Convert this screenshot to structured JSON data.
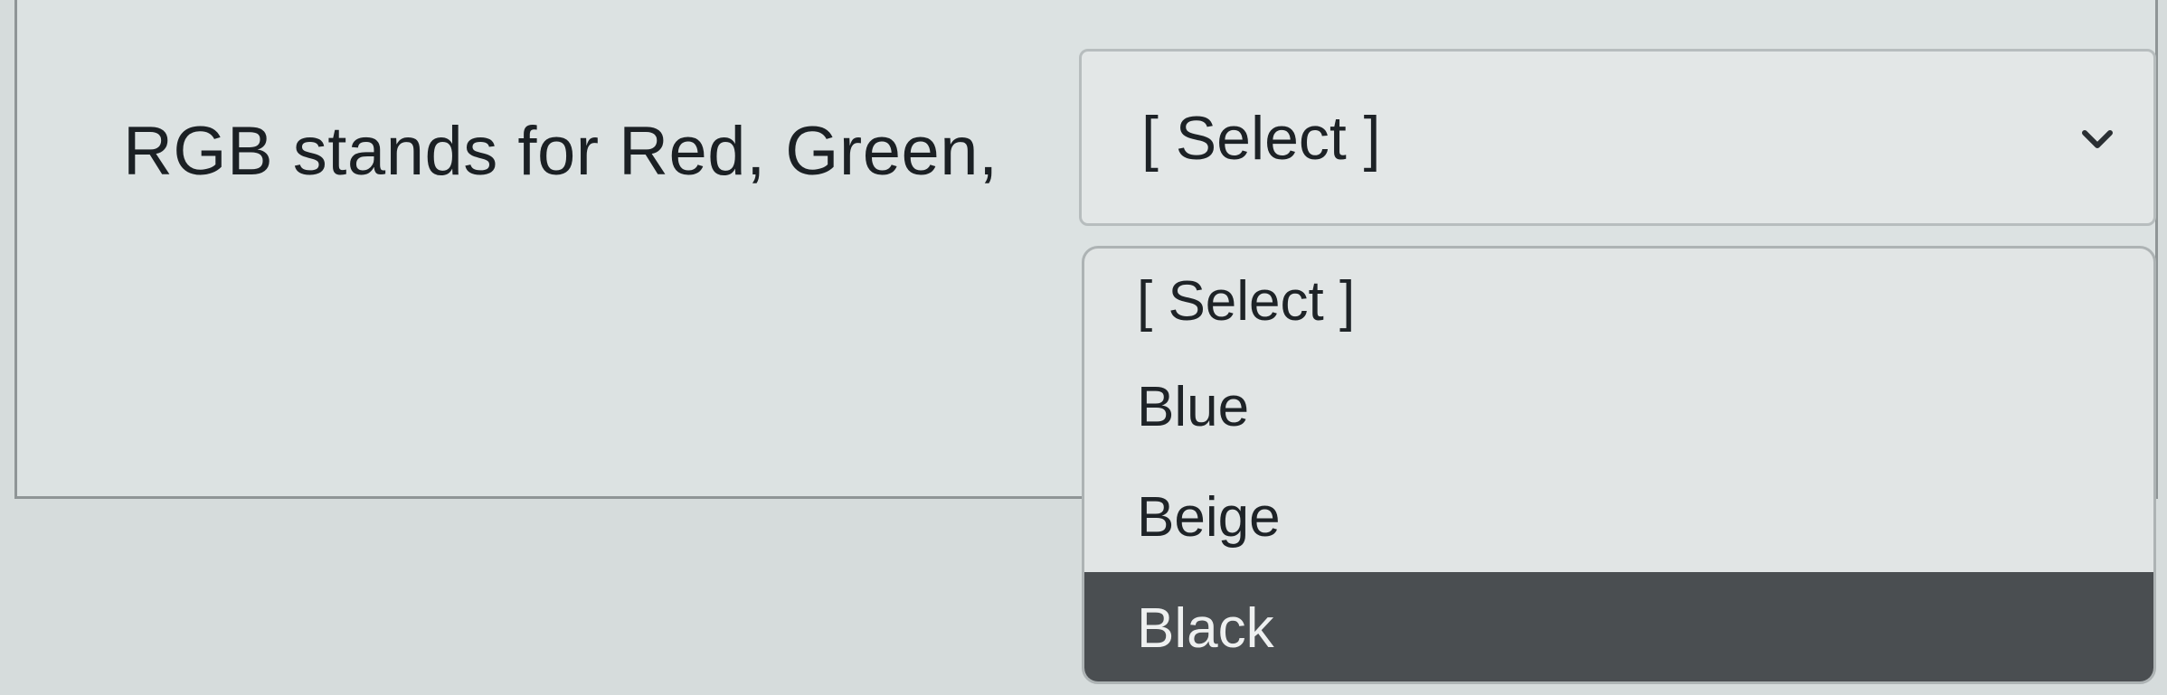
{
  "question": {
    "text": "RGB stands for Red, Green,"
  },
  "select": {
    "current_value": "[ Select ]",
    "chevron_icon": "chevron-down-icon",
    "options": [
      {
        "label": "[ Select ]",
        "highlighted": false
      },
      {
        "label": "Blue",
        "highlighted": false
      },
      {
        "label": "Beige",
        "highlighted": false
      },
      {
        "label": "Black",
        "highlighted": true
      }
    ]
  },
  "colors": {
    "highlight_background": "#4a4e51",
    "highlight_text": "#eef0f0",
    "page_background": "#d6dcdc"
  }
}
